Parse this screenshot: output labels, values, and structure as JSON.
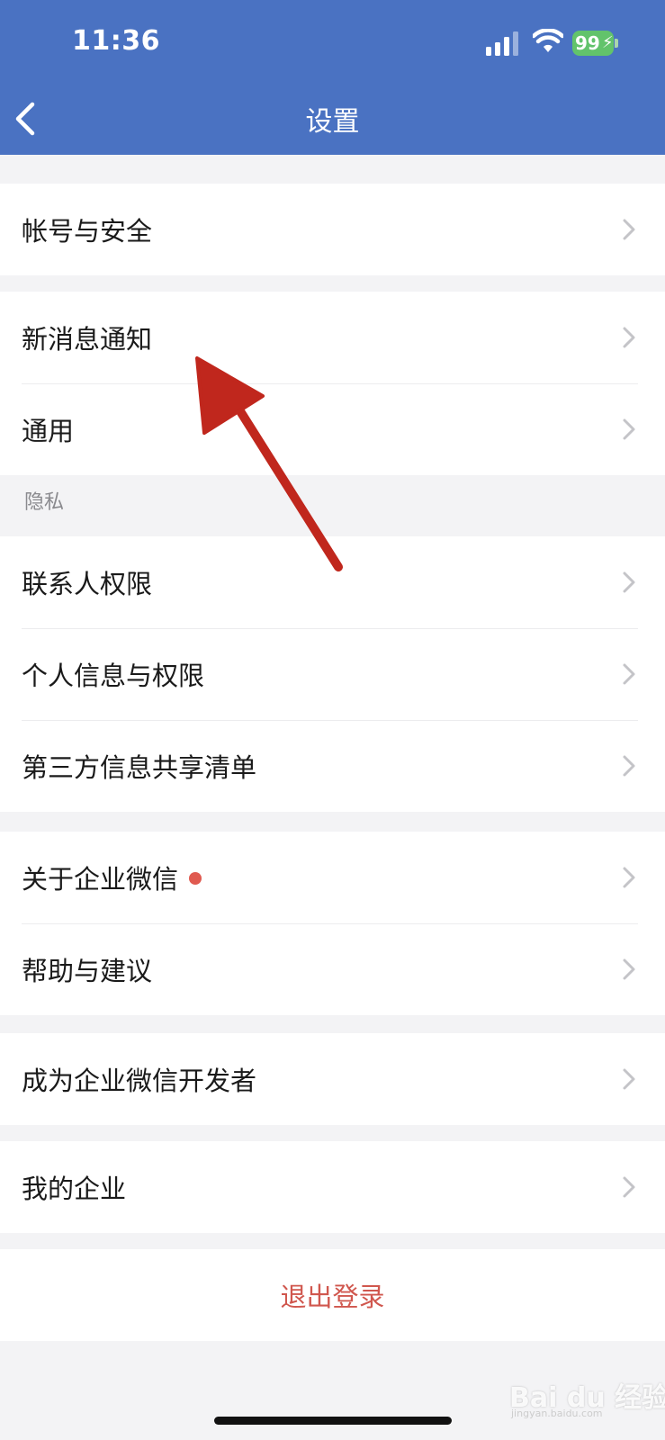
{
  "status_bar": {
    "time": "11:36",
    "battery": "99"
  },
  "nav": {
    "title": "设置"
  },
  "groups": [
    {
      "items": [
        {
          "label": "帐号与安全"
        }
      ]
    },
    {
      "items": [
        {
          "label": "新消息通知"
        },
        {
          "label": "通用"
        }
      ]
    },
    {
      "section": "隐私",
      "items": [
        {
          "label": "联系人权限"
        },
        {
          "label": "个人信息与权限"
        },
        {
          "label": "第三方信息共享清单"
        }
      ]
    },
    {
      "items": [
        {
          "label": "关于企业微信",
          "badge": "red-dot"
        },
        {
          "label": "帮助与建议"
        }
      ]
    },
    {
      "items": [
        {
          "label": "成为企业微信开发者"
        }
      ]
    },
    {
      "items": [
        {
          "label": "我的企业"
        }
      ]
    }
  ],
  "logout": {
    "label": "退出登录"
  },
  "watermark": {
    "text": "Bai du 经验",
    "sub": "jingyan.baidu.com"
  },
  "colors": {
    "header": "#4a72c2",
    "logout": "#d0574e",
    "badge": "#e05a50",
    "annotation_arrow": "#c0271d"
  }
}
